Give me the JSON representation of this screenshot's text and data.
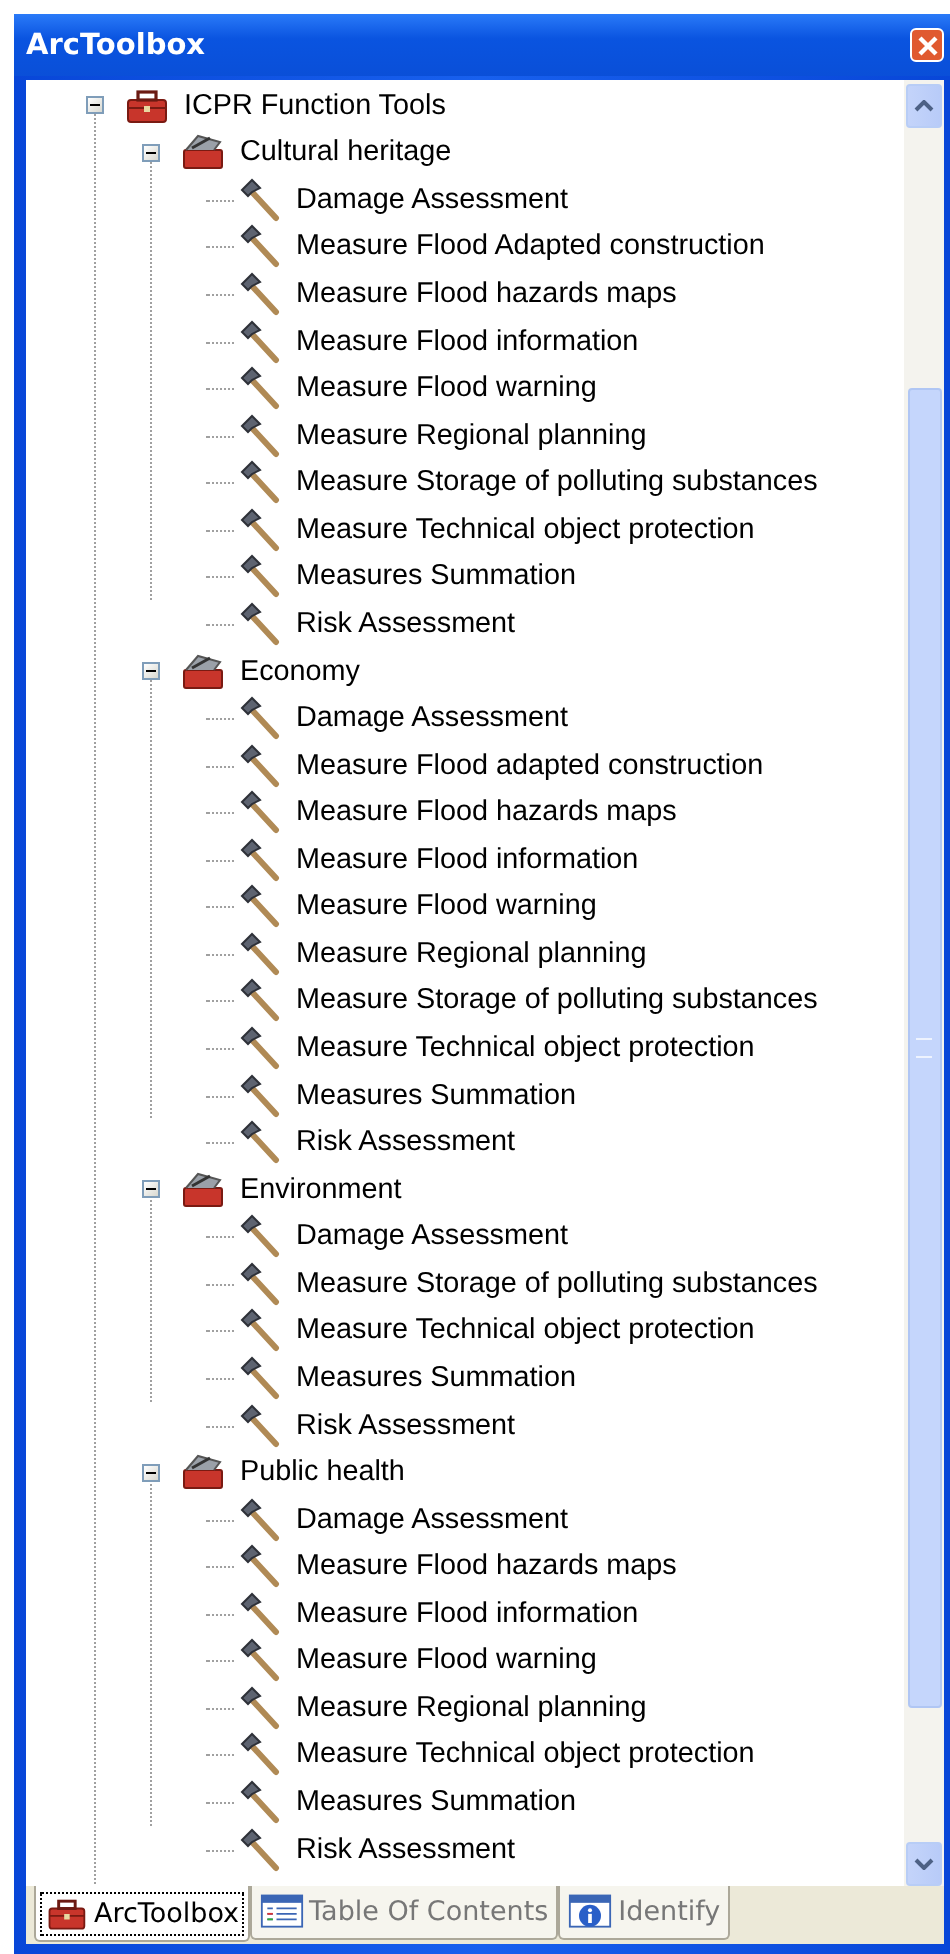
{
  "window": {
    "title": "ArcToolbox"
  },
  "tree": [
    {
      "label": "ICPR Function Tools",
      "kind": "toolbox",
      "expanded": true,
      "children": [
        {
          "label": "Cultural heritage",
          "kind": "toolset",
          "expanded": true,
          "children": [
            {
              "label": "Damage Assessment",
              "kind": "tool"
            },
            {
              "label": "Measure Flood Adapted construction",
              "kind": "tool"
            },
            {
              "label": "Measure Flood hazards maps",
              "kind": "tool"
            },
            {
              "label": "Measure Flood information",
              "kind": "tool"
            },
            {
              "label": "Measure Flood warning",
              "kind": "tool"
            },
            {
              "label": "Measure Regional planning",
              "kind": "tool"
            },
            {
              "label": "Measure Storage of polluting substances",
              "kind": "tool"
            },
            {
              "label": "Measure Technical object protection",
              "kind": "tool"
            },
            {
              "label": "Measures Summation",
              "kind": "tool"
            },
            {
              "label": "Risk Assessment",
              "kind": "tool"
            }
          ]
        },
        {
          "label": "Economy",
          "kind": "toolset",
          "expanded": true,
          "children": [
            {
              "label": "Damage Assessment",
              "kind": "tool"
            },
            {
              "label": "Measure Flood adapted construction",
              "kind": "tool"
            },
            {
              "label": "Measure Flood hazards maps",
              "kind": "tool"
            },
            {
              "label": "Measure Flood information",
              "kind": "tool"
            },
            {
              "label": "Measure Flood warning",
              "kind": "tool"
            },
            {
              "label": "Measure Regional planning",
              "kind": "tool"
            },
            {
              "label": "Measure Storage of polluting substances",
              "kind": "tool"
            },
            {
              "label": "Measure Technical object protection",
              "kind": "tool"
            },
            {
              "label": "Measures Summation",
              "kind": "tool"
            },
            {
              "label": "Risk Assessment",
              "kind": "tool"
            }
          ]
        },
        {
          "label": "Environment",
          "kind": "toolset",
          "expanded": true,
          "children": [
            {
              "label": "Damage Assessment",
              "kind": "tool"
            },
            {
              "label": "Measure Storage of polluting substances",
              "kind": "tool"
            },
            {
              "label": "Measure Technical object protection",
              "kind": "tool"
            },
            {
              "label": "Measures Summation",
              "kind": "tool"
            },
            {
              "label": "Risk Assessment",
              "kind": "tool"
            }
          ]
        },
        {
          "label": "Public health",
          "kind": "toolset",
          "expanded": true,
          "children": [
            {
              "label": "Damage Assessment",
              "kind": "tool"
            },
            {
              "label": "Measure Flood hazards maps",
              "kind": "tool"
            },
            {
              "label": "Measure Flood information",
              "kind": "tool"
            },
            {
              "label": "Measure Flood warning",
              "kind": "tool"
            },
            {
              "label": "Measure Regional planning",
              "kind": "tool"
            },
            {
              "label": "Measure Technical object protection",
              "kind": "tool"
            },
            {
              "label": "Measures Summation",
              "kind": "tool"
            },
            {
              "label": "Risk Assessment",
              "kind": "tool"
            }
          ]
        }
      ]
    }
  ],
  "tabs": [
    {
      "label": "ArcToolbox",
      "kind": "toolbox",
      "selected": true
    },
    {
      "label": "Table Of Contents",
      "kind": "contents",
      "selected": false
    },
    {
      "label": "Identify",
      "kind": "identify",
      "selected": false
    }
  ]
}
